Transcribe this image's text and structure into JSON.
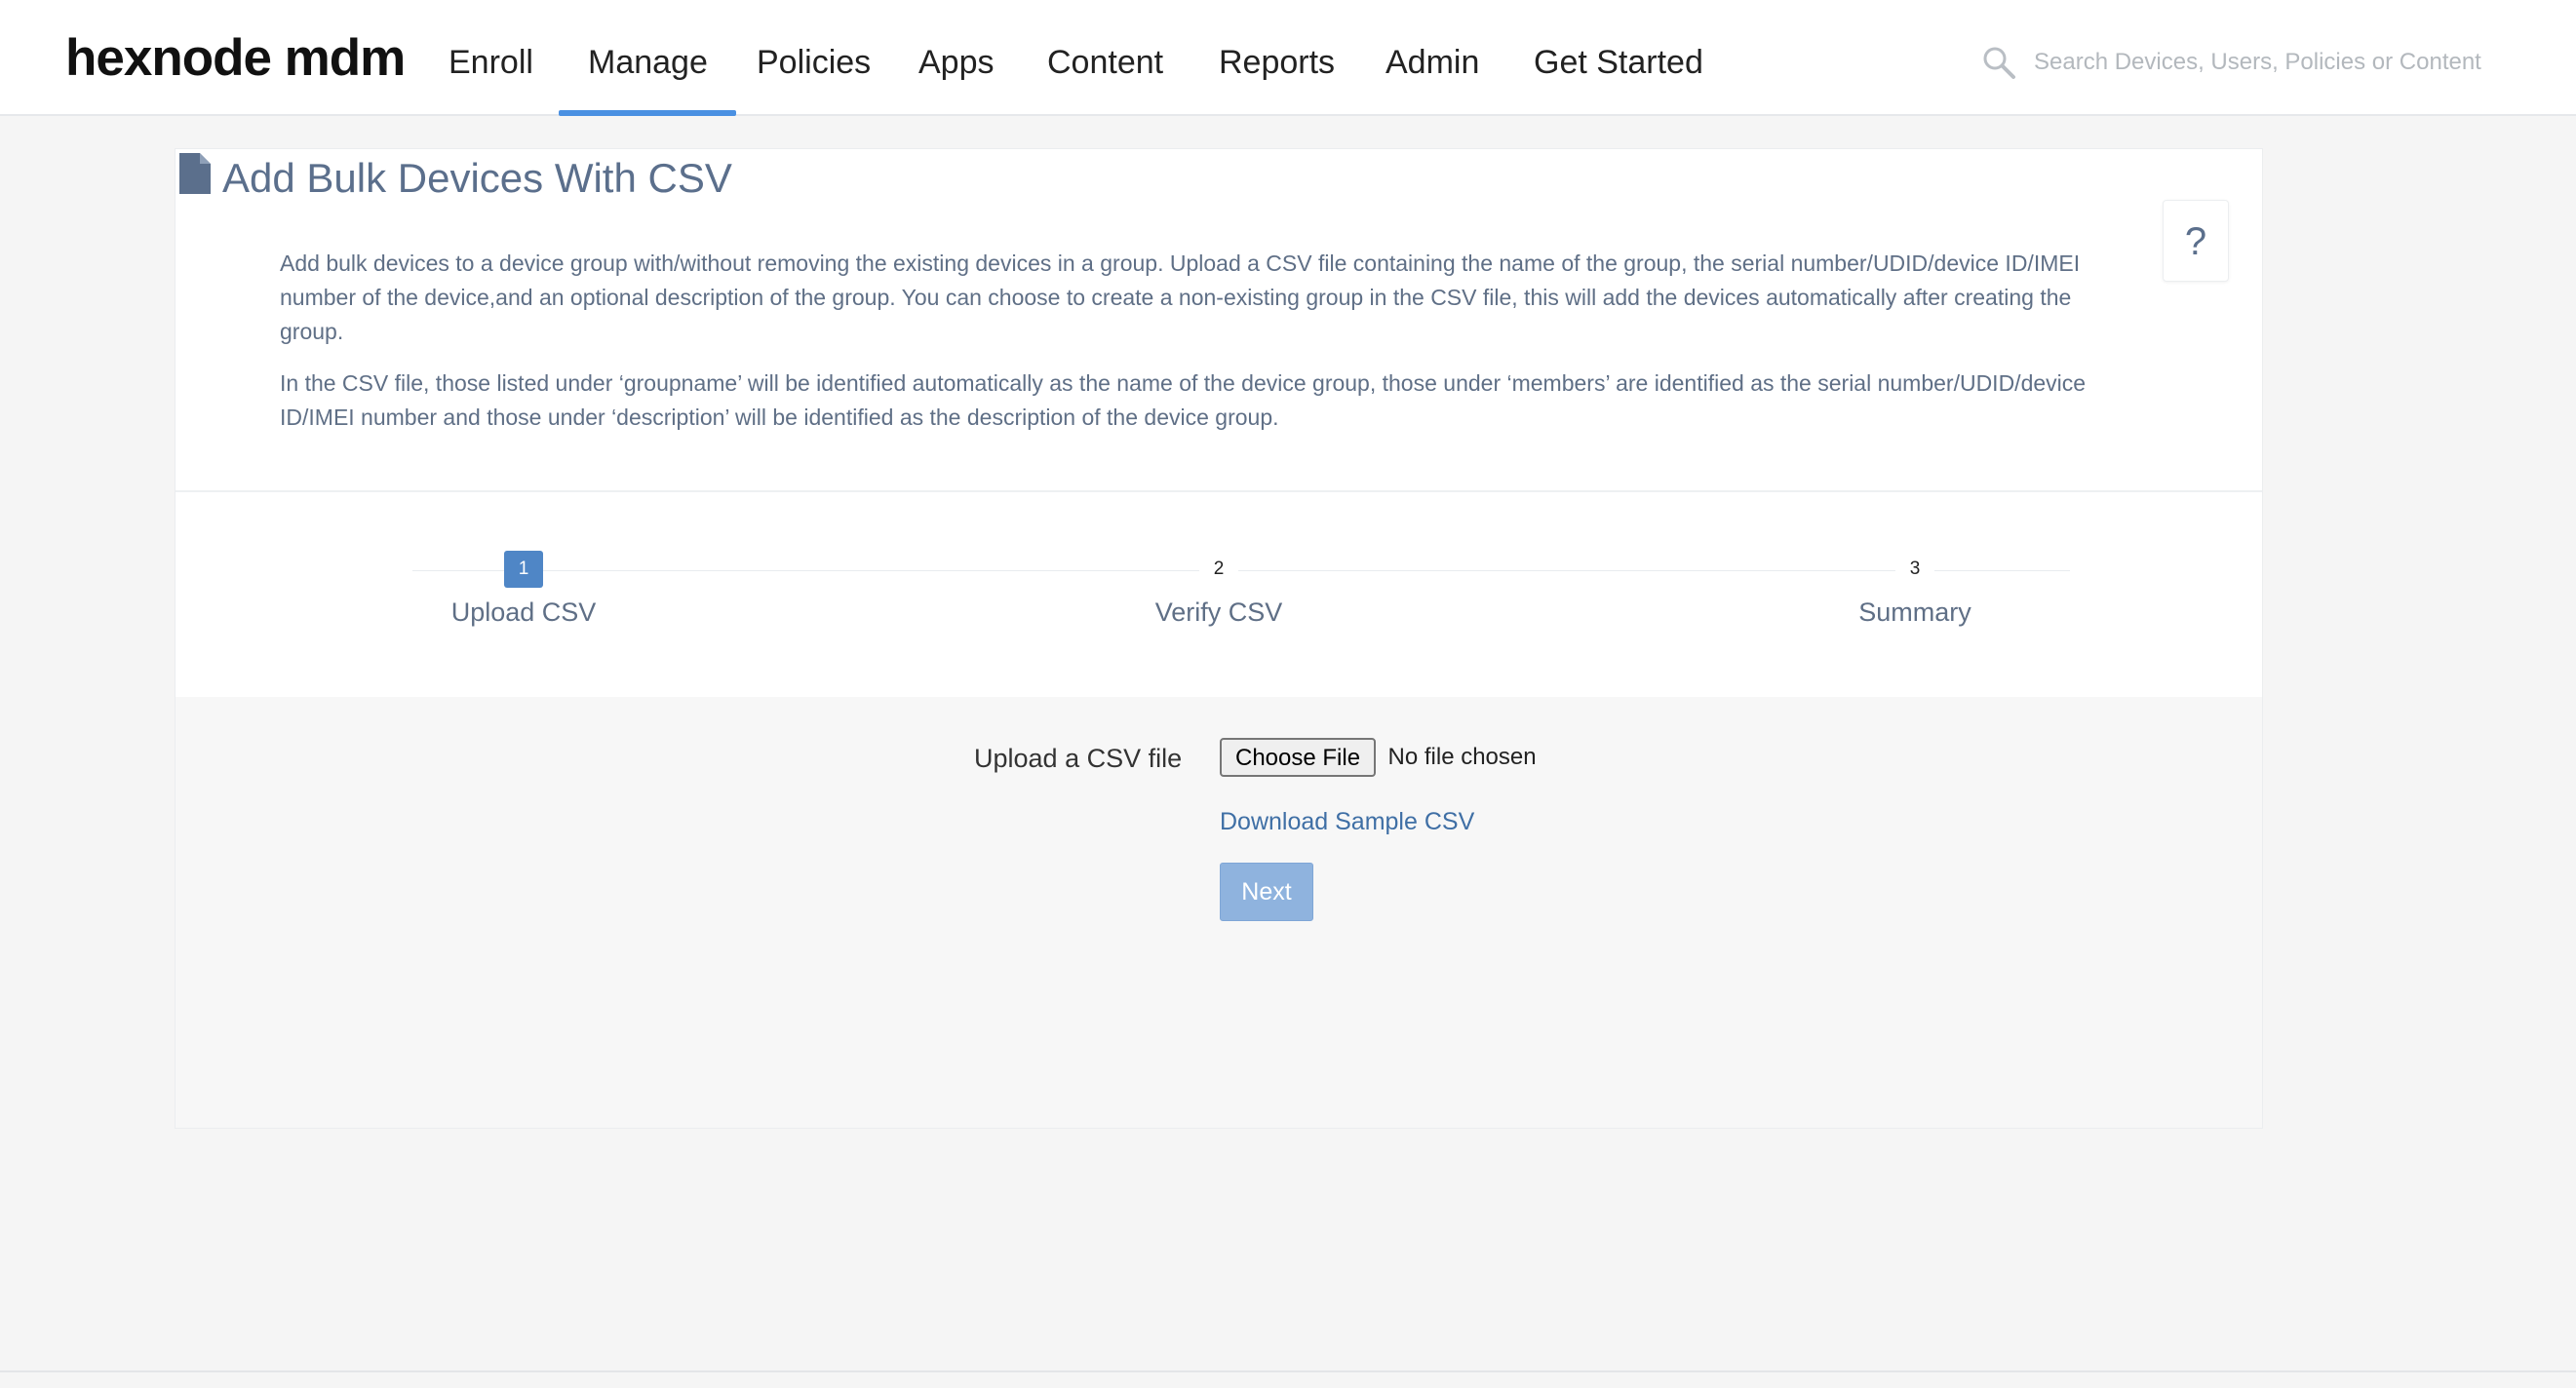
{
  "app": {
    "logo": "hexnode mdm"
  },
  "nav": {
    "items": [
      {
        "label": "Enroll"
      },
      {
        "label": "Manage"
      },
      {
        "label": "Policies"
      },
      {
        "label": "Apps"
      },
      {
        "label": "Content"
      },
      {
        "label": "Reports"
      },
      {
        "label": "Admin"
      },
      {
        "label": "Get Started"
      }
    ],
    "active": "Manage"
  },
  "search": {
    "placeholder": "Search Devices, Users, Policies or Content",
    "icon": "search-icon"
  },
  "page": {
    "title": "Add Bulk Devices With CSV",
    "title_icon": "document-icon",
    "help_label": "?",
    "description": [
      "Add bulk devices to a device group with/without removing the existing devices in a group. Upload a CSV file containing the name of the group, the serial number/UDID/device ID/IMEI number of the device,and an optional description of the group. You can choose to create a non-existing group in the CSV file, this will add the devices automatically after creating the group.",
      "In the CSV file, those listed under ‘groupname’ will be identified automatically as the name of the device group, those under ‘members’ are identified as the serial number/UDID/device ID/IMEI number and those under ‘description’ will be identified as the description of the device group."
    ]
  },
  "stepper": {
    "steps": [
      {
        "number": "1",
        "label": "Upload CSV",
        "active": true
      },
      {
        "number": "2",
        "label": "Verify CSV",
        "active": false
      },
      {
        "number": "3",
        "label": "Summary",
        "active": false
      }
    ]
  },
  "upload": {
    "label": "Upload a CSV file",
    "choose_file_label": "Choose File",
    "file_status": "No file chosen",
    "download_link": "Download Sample CSV",
    "next_label": "Next"
  },
  "colors": {
    "accent": "#4a90e2",
    "step_active": "#4f86c6",
    "next_button": "#8fb3de",
    "title_text": "#5b6f8c",
    "link": "#3f6fa5"
  }
}
